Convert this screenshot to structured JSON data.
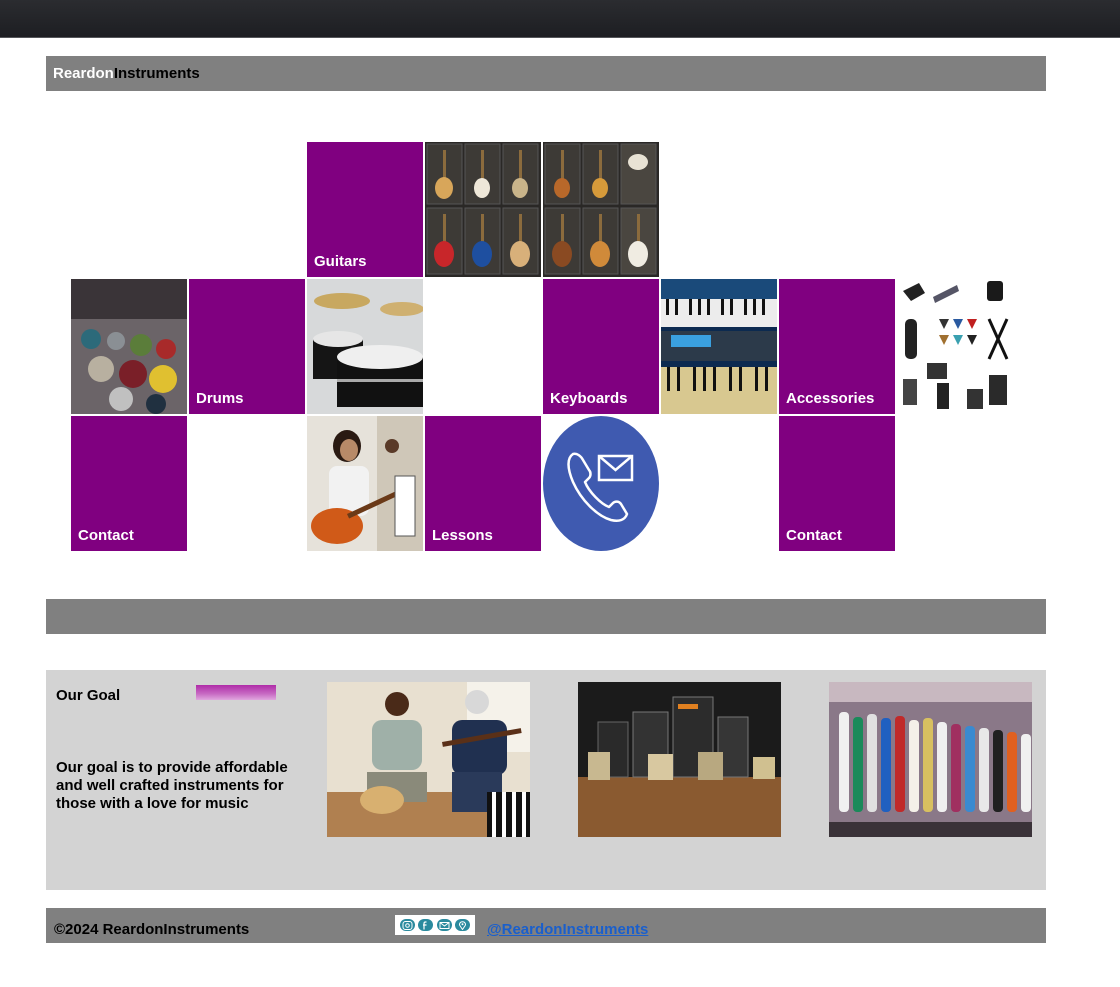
{
  "header": {
    "brand_first": "Reardon",
    "brand_second": "Instruments"
  },
  "tiles": {
    "guitars_label": "Guitars",
    "drums_label": "Drums",
    "keyboards_label": "Keyboards",
    "accessories_label": "Accessories",
    "contact_left_label": "Contact",
    "lessons_label": "Lessons",
    "contact_right_label": "Contact"
  },
  "goal": {
    "title": "Our Goal",
    "text": "Our goal is to provide affordable and well crafted instruments for those with a love for music"
  },
  "footer": {
    "copyright": "©2024 ReardonInstruments",
    "handle": "@ReardonInstruments",
    "social_icons": [
      "instagram-icon",
      "facebook-icon",
      "email-icon",
      "location-icon"
    ]
  },
  "colors": {
    "tile_purple": "#800080",
    "bar_gray": "#808080",
    "panel_gray": "#d3d3d3",
    "phone_blue": "#3f5ab0"
  }
}
